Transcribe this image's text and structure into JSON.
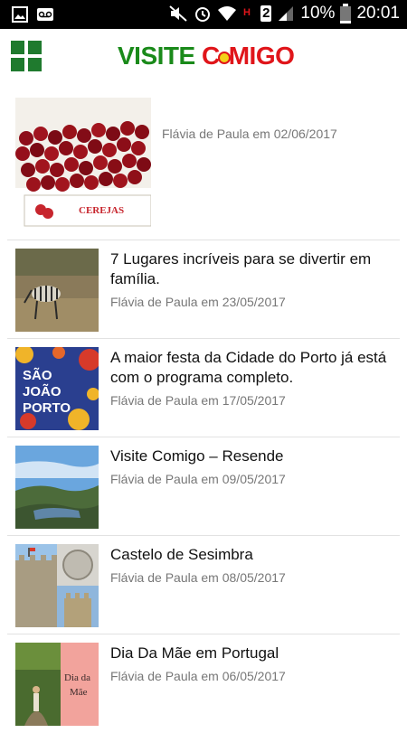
{
  "status_bar": {
    "battery": "10%",
    "time": "20:01",
    "sim": "2",
    "icons": [
      "image-icon",
      "voicemail-icon",
      "mute-icon",
      "alarm-icon",
      "wifi-icon",
      "signal-icon",
      "battery-icon"
    ]
  },
  "app_bar": {
    "logo_part1": "VISITE",
    "logo_part2": "C",
    "logo_part3": "MIGO",
    "menu_icon": "grid-menu-icon"
  },
  "posts": [
    {
      "title": "",
      "meta": "Flávia de Paula em 02/06/2017",
      "thumb": "cherries"
    },
    {
      "title": "7 Lugares incríveis para se divertir em família.",
      "meta": "Flávia de Paula em 23/05/2017",
      "thumb": "zebra"
    },
    {
      "title": "A maior festa da Cidade do Porto já está com o programa completo.",
      "meta": "Flávia de Paula em 17/05/2017",
      "thumb": "sao-joao-porto"
    },
    {
      "title": "Visite Comigo – Resende",
      "meta": "Flávia de Paula em 09/05/2017",
      "thumb": "river-valley"
    },
    {
      "title": "Castelo de Sesimbra",
      "meta": "Flávia de Paula em 08/05/2017",
      "thumb": "castle"
    },
    {
      "title": "Dia Da Mãe em Portugal",
      "meta": "Flávia de Paula em 06/05/2017",
      "thumb": "dia-da-mae"
    }
  ],
  "thumb_text": {
    "cerejas": "CEREJAS",
    "sao": "SÃO",
    "joao": "JOÃO",
    "porto": "PORTO",
    "dia_da": "Dia da",
    "mae": "Mãe"
  },
  "colors": {
    "logo_green": "#1a8a1a",
    "logo_red": "#e0151a",
    "divider": "#e2e2e2",
    "meta_gray": "#777777"
  }
}
